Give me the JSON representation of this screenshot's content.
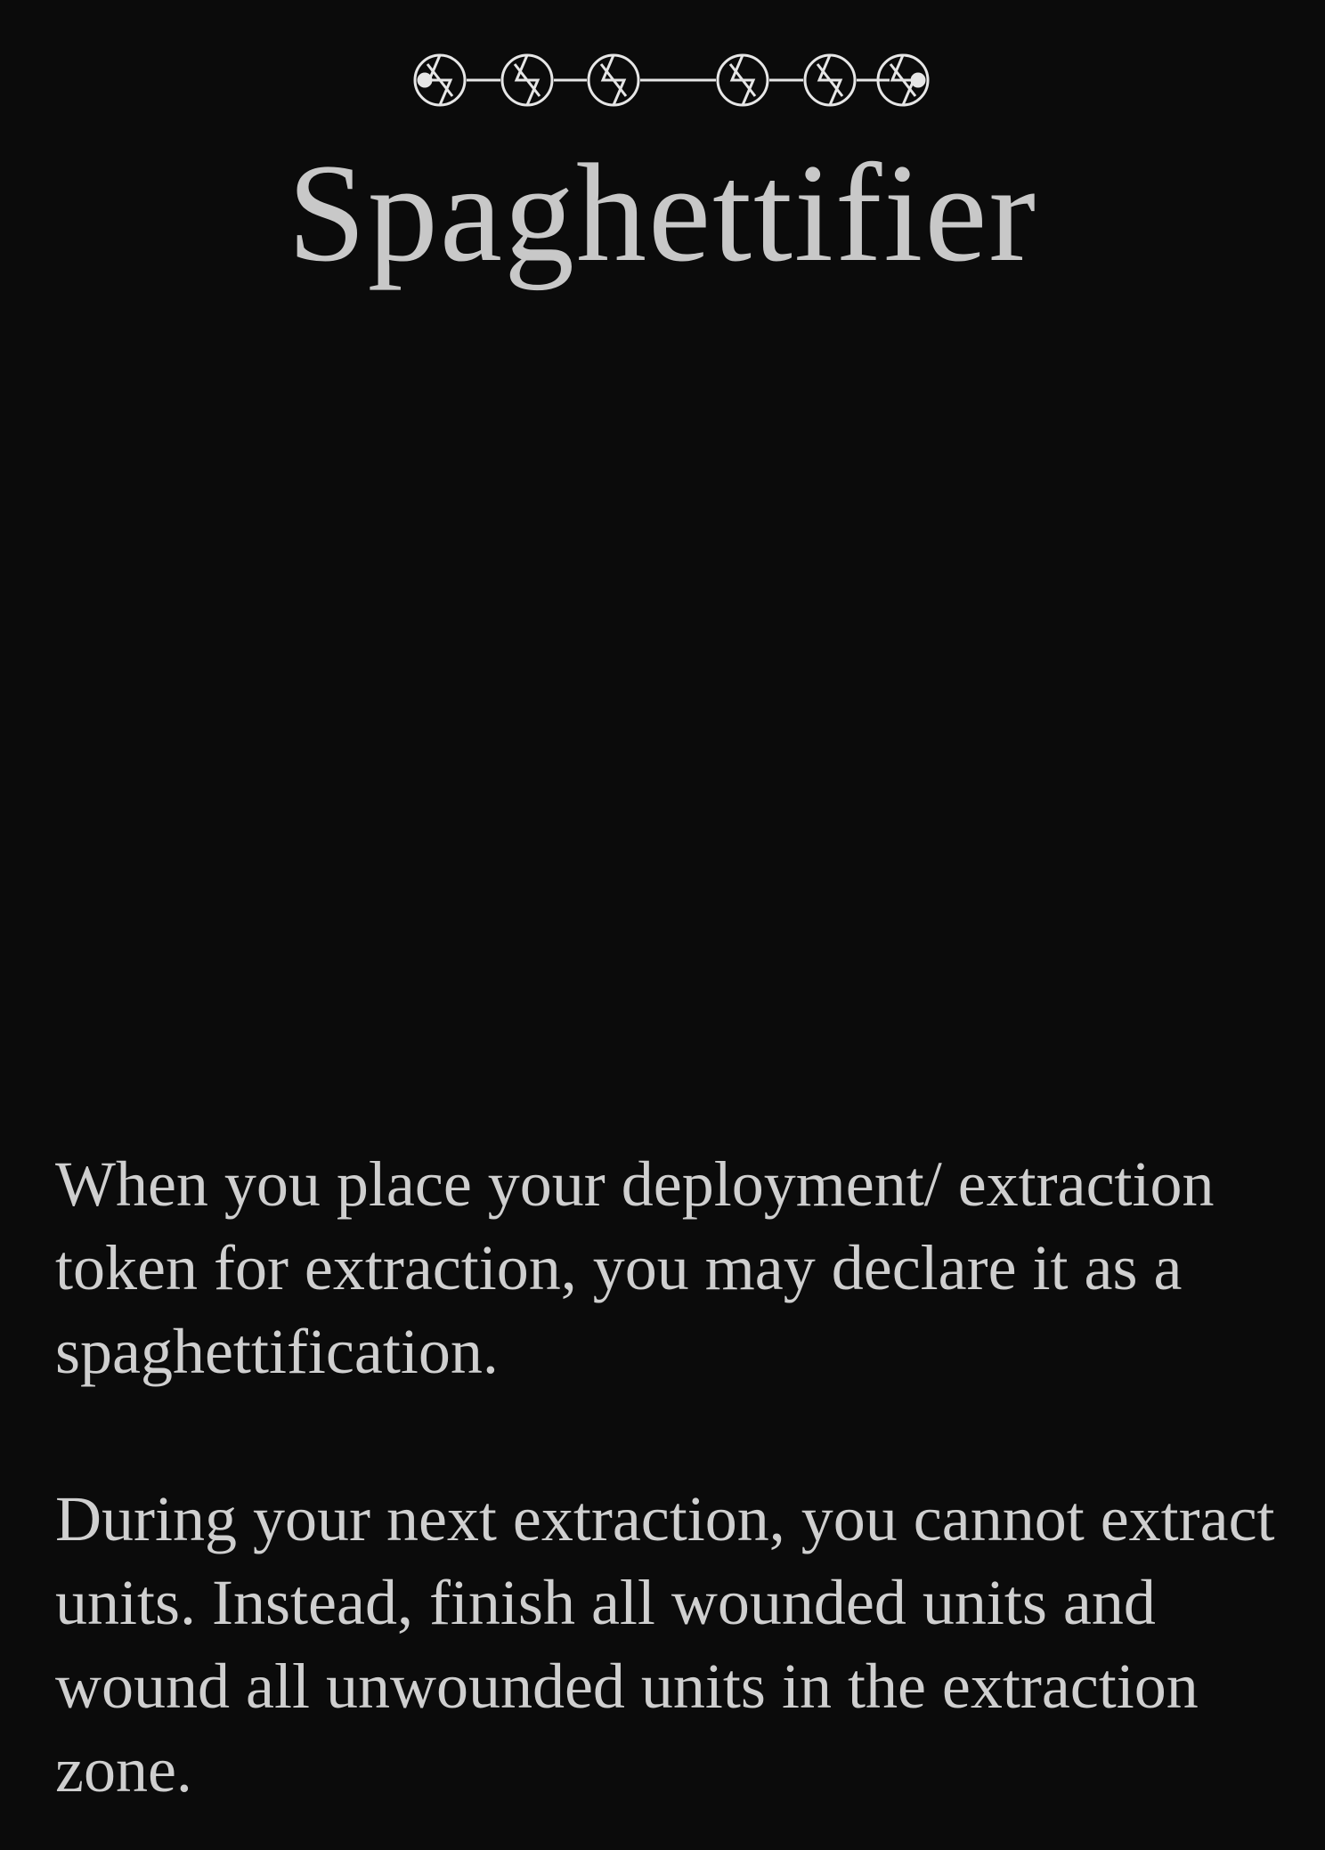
{
  "card": {
    "title": "Spaghettifier",
    "ornament_icon": "rune-divider-icon",
    "paragraphs": [
      "When you place your deployment/ extraction token for extraction, you may declare it as a spaghettification.",
      "During your next extraction, you cannot extract units. Instead, finish all wounded units and wound all unwounded units in the extraction zone."
    ]
  },
  "colors": {
    "background": "#0b0b0b",
    "text": "#d2d2d2",
    "ornament": "#e6e6e6"
  }
}
